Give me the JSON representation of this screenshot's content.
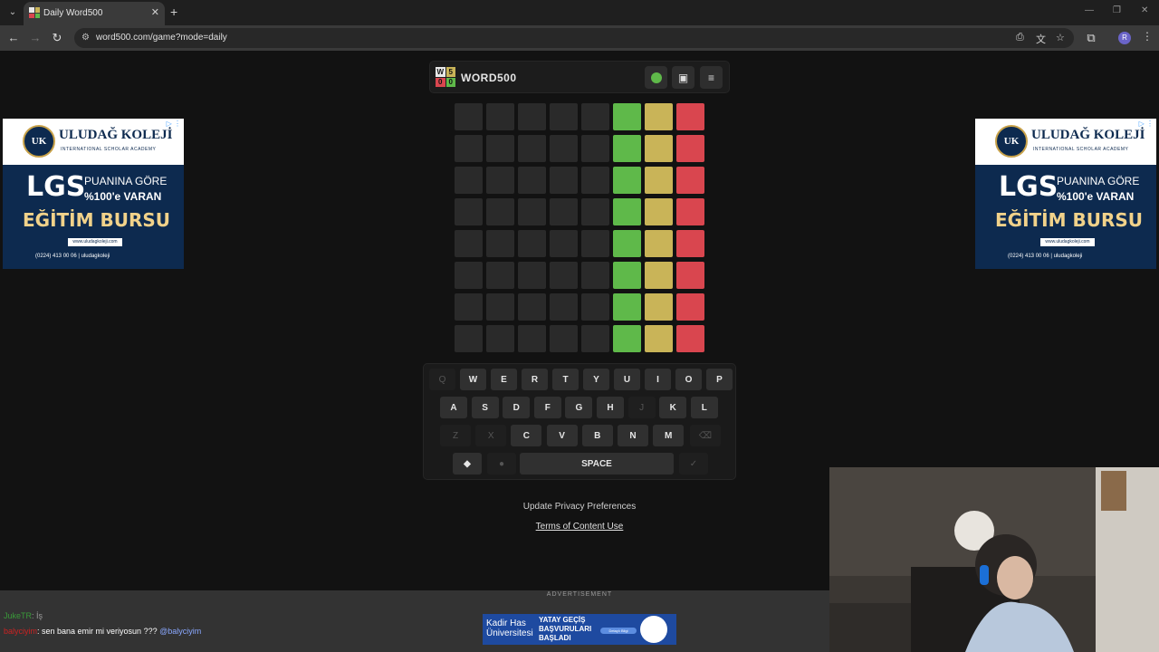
{
  "browser": {
    "tab_title": "Daily Word500",
    "tab_close": "✕",
    "new_tab": "+",
    "url": "word500.com/game?mode=daily",
    "win_minimize": "—",
    "win_restore": "❐",
    "win_close": "✕",
    "profile_initial": "R"
  },
  "game": {
    "logo_letters": [
      "W",
      "5",
      "0",
      "0"
    ],
    "logo_colors": [
      "#e8e8e8",
      "#c9b458",
      "#d9464f",
      "#5fb94a"
    ],
    "title": "WORD500",
    "board": {
      "rows": 8,
      "columns": 8,
      "column_colors": [
        "#2a2a2a",
        "#2a2a2a",
        "#2a2a2a",
        "#2a2a2a",
        "#2a2a2a",
        "#5fb94a",
        "#c9b458",
        "#d9464f"
      ]
    },
    "keyboard": {
      "row1": [
        "Q",
        "W",
        "E",
        "R",
        "T",
        "Y",
        "U",
        "I",
        "O",
        "P"
      ],
      "row2": [
        "A",
        "S",
        "D",
        "F",
        "G",
        "H",
        "J",
        "K",
        "L"
      ],
      "row3": [
        "Z",
        "X",
        "C",
        "V",
        "B",
        "N",
        "M"
      ],
      "space_label": "SPACE",
      "disabled": [
        "Q",
        "J",
        "Z",
        "X"
      ]
    }
  },
  "footer": {
    "privacy": "Update Privacy Preferences",
    "terms": "Terms of Content Use"
  },
  "ads": {
    "brand": "ULUDAĞ KOLEJİ",
    "sub": "INTERNATIONAL SCHOLAR ACADEMY",
    "crest": "UK",
    "lgs": "LGS",
    "line1": "PUANINA GÖRE",
    "line2": "%100'e VARAN",
    "line3": "EĞİTİM BURSU",
    "web": "www.uludagkoleji.com",
    "phone": "(0224) 413 00 06 | uludagkoleji",
    "choice": "▷ ⋮"
  },
  "bottom": {
    "ad_label": "ADVERTISEMENT",
    "chat": [
      {
        "user": "JukeTR",
        "message": ": İş",
        "user_color": "#3a9a3a"
      },
      {
        "user": "balyciyim",
        "message": ": sen bana emir mi veriyosun ??? ",
        "mention": "@balyciyim",
        "user_color": "#cc2222"
      }
    ],
    "banner_left": "Kadir Has Üniversitesi",
    "banner_mid": "YATAY GEÇİŞ BAŞVURULARI BAŞLADI",
    "banner_btn": "Detaylı Bilgi"
  }
}
